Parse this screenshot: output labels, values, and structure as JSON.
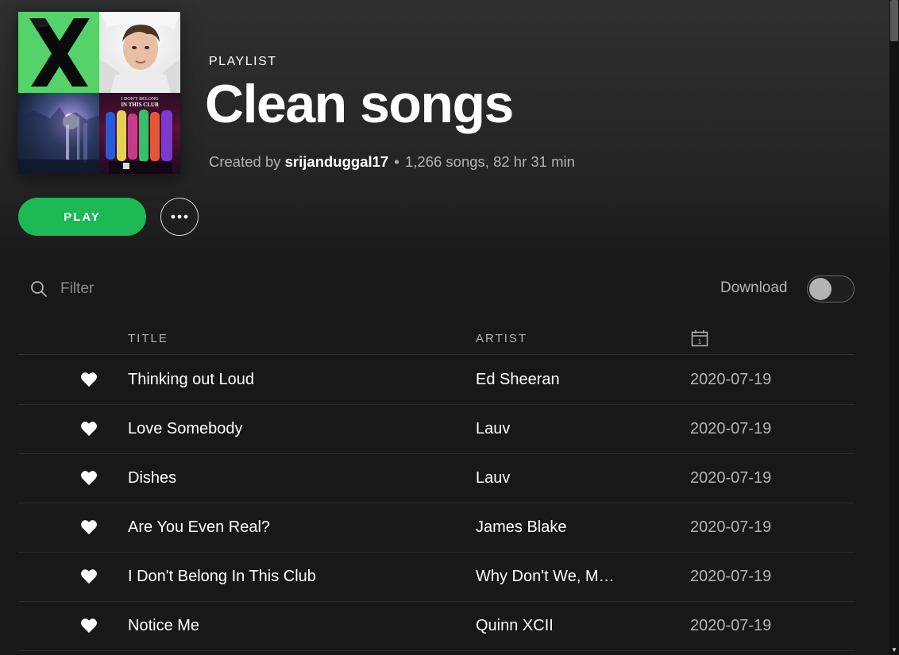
{
  "header": {
    "type_label": "PLAYLIST",
    "title": "Clean songs",
    "created_by_prefix": "Created by",
    "owner": "srijanduggal17",
    "separator": "•",
    "stats": "1,266 songs, 82 hr 31 min"
  },
  "cover": {
    "tiles": [
      "album-x",
      "artist-portrait",
      "album-lake",
      "album-i-dont-belong-in-this-club"
    ],
    "tile4_text_line1": "I DON'T BELONG",
    "tile4_text_line2": "IN THIS CLUB",
    "colors": {
      "x_green": "#55d26a"
    }
  },
  "actions": {
    "play_label": "PLAY",
    "more_icon": "more-horizontal-icon"
  },
  "filter": {
    "placeholder": "Filter",
    "icon": "search-icon"
  },
  "download": {
    "label": "Download",
    "enabled": false
  },
  "table": {
    "columns": {
      "title": "TITLE",
      "artist": "ARTIST",
      "date_icon": "calendar-icon",
      "date_icon_text": "1"
    },
    "rows": [
      {
        "title": "Thinking out Loud",
        "artist": "Ed Sheeran",
        "date": "2020-07-19",
        "liked": true
      },
      {
        "title": "Love Somebody",
        "artist": "Lauv",
        "date": "2020-07-19",
        "liked": true
      },
      {
        "title": "Dishes",
        "artist": "Lauv",
        "date": "2020-07-19",
        "liked": true
      },
      {
        "title": "Are You Even Real?",
        "artist": "James Blake",
        "date": "2020-07-19",
        "liked": true
      },
      {
        "title": "I Don't Belong In This Club",
        "artist": "Why Don't We, M…",
        "date": "2020-07-19",
        "liked": true
      },
      {
        "title": "Notice Me",
        "artist": "Quinn XCII",
        "date": "2020-07-19",
        "liked": true
      }
    ]
  },
  "colors": {
    "accent": "#1db954",
    "background": "#181818",
    "text_secondary": "#b3b3b3"
  }
}
